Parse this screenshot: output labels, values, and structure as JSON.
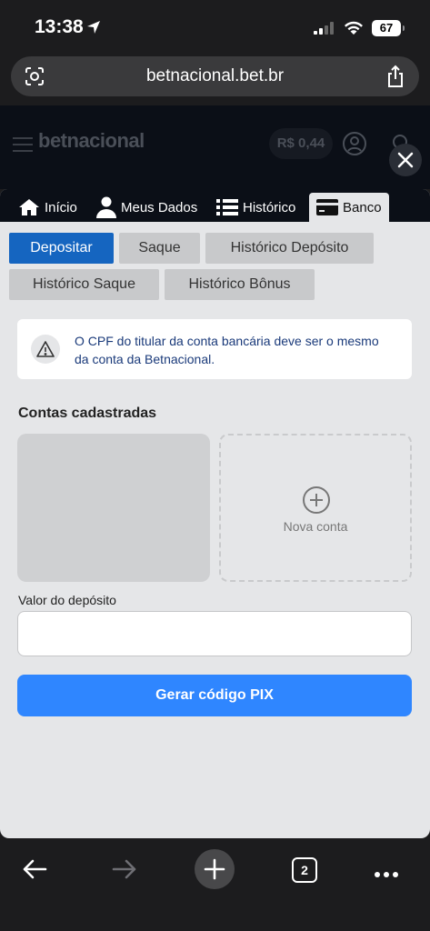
{
  "status_bar": {
    "time": "13:38",
    "battery": "67"
  },
  "browser": {
    "url": "betnacional.bet.br",
    "tab_count": "2"
  },
  "site_header": {
    "logo": "betnacional",
    "balance": "R$ 0,44"
  },
  "top_tabs": [
    {
      "label": "Início",
      "icon": "home-icon"
    },
    {
      "label": "Meus Dados",
      "icon": "person-icon"
    },
    {
      "label": "Histórico",
      "icon": "list-icon"
    },
    {
      "label": "Banco",
      "icon": "card-icon",
      "active": true
    }
  ],
  "sub_tabs": [
    {
      "label": "Depositar",
      "active": true
    },
    {
      "label": "Saque"
    },
    {
      "label": "Histórico Depósito"
    },
    {
      "label": "Histórico Saque"
    },
    {
      "label": "Histórico Bônus"
    }
  ],
  "notice": {
    "icon": "warning-icon",
    "line1": "O CPF do titular da conta bancária deve ser o mesmo",
    "line2": "da conta da Betnacional."
  },
  "accounts": {
    "title": "Contas cadastradas",
    "new_account_label": "Nova conta"
  },
  "deposit": {
    "label": "Valor do depósito",
    "value": "",
    "button": "Gerar código PIX"
  },
  "colors": {
    "primary": "#2f86ff",
    "active_tab": "#1565c0",
    "header": "#0b0f17"
  }
}
